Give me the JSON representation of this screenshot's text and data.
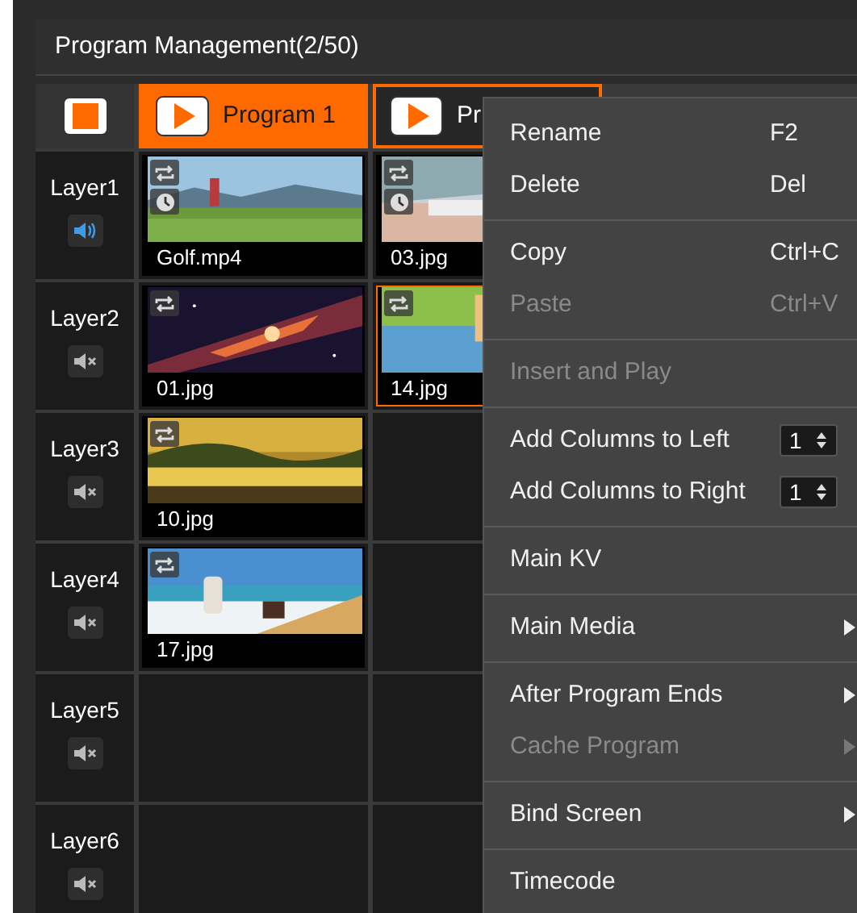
{
  "panel": {
    "title": "Program Management(2/50)"
  },
  "programs": [
    {
      "label": "Program 1",
      "selected": true
    },
    {
      "label": "Pr",
      "selected": false
    }
  ],
  "layers": [
    {
      "name": "Layer1",
      "muted": false,
      "clips": [
        {
          "name": "Golf.mp4",
          "loop": true,
          "timed": true,
          "selected": false,
          "kind": "picture"
        },
        {
          "name": "03.jpg",
          "loop": true,
          "timed": true,
          "selected": false,
          "kind": "picture"
        }
      ]
    },
    {
      "name": "Layer2",
      "muted": true,
      "clips": [
        {
          "name": "01.jpg",
          "loop": true,
          "timed": false,
          "selected": false,
          "kind": "picture"
        },
        {
          "name": "14.jpg",
          "loop": true,
          "timed": false,
          "selected": true,
          "kind": "picture"
        }
      ]
    },
    {
      "name": "Layer3",
      "muted": true,
      "clips": [
        {
          "name": "10.jpg",
          "loop": true,
          "timed": false,
          "selected": false,
          "kind": "picture"
        }
      ]
    },
    {
      "name": "Layer4",
      "muted": true,
      "clips": [
        {
          "name": "17.jpg",
          "loop": true,
          "timed": false,
          "selected": false,
          "kind": "picture"
        }
      ]
    },
    {
      "name": "Layer5",
      "muted": true
    },
    {
      "name": "Layer6",
      "muted": true
    }
  ],
  "context_menu": [
    {
      "kind": "item",
      "label": "Rename",
      "shortcut": "F2",
      "disabled": false
    },
    {
      "kind": "item",
      "label": "Delete",
      "shortcut": "Del",
      "disabled": false
    },
    {
      "kind": "separator"
    },
    {
      "kind": "item",
      "label": "Copy",
      "shortcut": "Ctrl+C",
      "disabled": false
    },
    {
      "kind": "item",
      "label": "Paste",
      "shortcut": "Ctrl+V",
      "disabled": true
    },
    {
      "kind": "separator"
    },
    {
      "kind": "item",
      "label": "Insert and Play",
      "disabled": true
    },
    {
      "kind": "separator"
    },
    {
      "kind": "spin",
      "label": "Add Columns to Left",
      "value": "1",
      "disabled": false
    },
    {
      "kind": "spin",
      "label": "Add Columns to Right",
      "value": "1",
      "disabled": false
    },
    {
      "kind": "separator"
    },
    {
      "kind": "item",
      "label": "Main KV",
      "disabled": false
    },
    {
      "kind": "separator"
    },
    {
      "kind": "submenu",
      "label": "Main Media",
      "disabled": false
    },
    {
      "kind": "separator"
    },
    {
      "kind": "submenu",
      "label": "After Program Ends",
      "disabled": false
    },
    {
      "kind": "submenu",
      "label": "Cache Program",
      "disabled": true
    },
    {
      "kind": "separator"
    },
    {
      "kind": "submenu",
      "label": "Bind Screen",
      "disabled": false
    },
    {
      "kind": "separator"
    },
    {
      "kind": "item",
      "label": "Timecode",
      "disabled": false
    }
  ]
}
